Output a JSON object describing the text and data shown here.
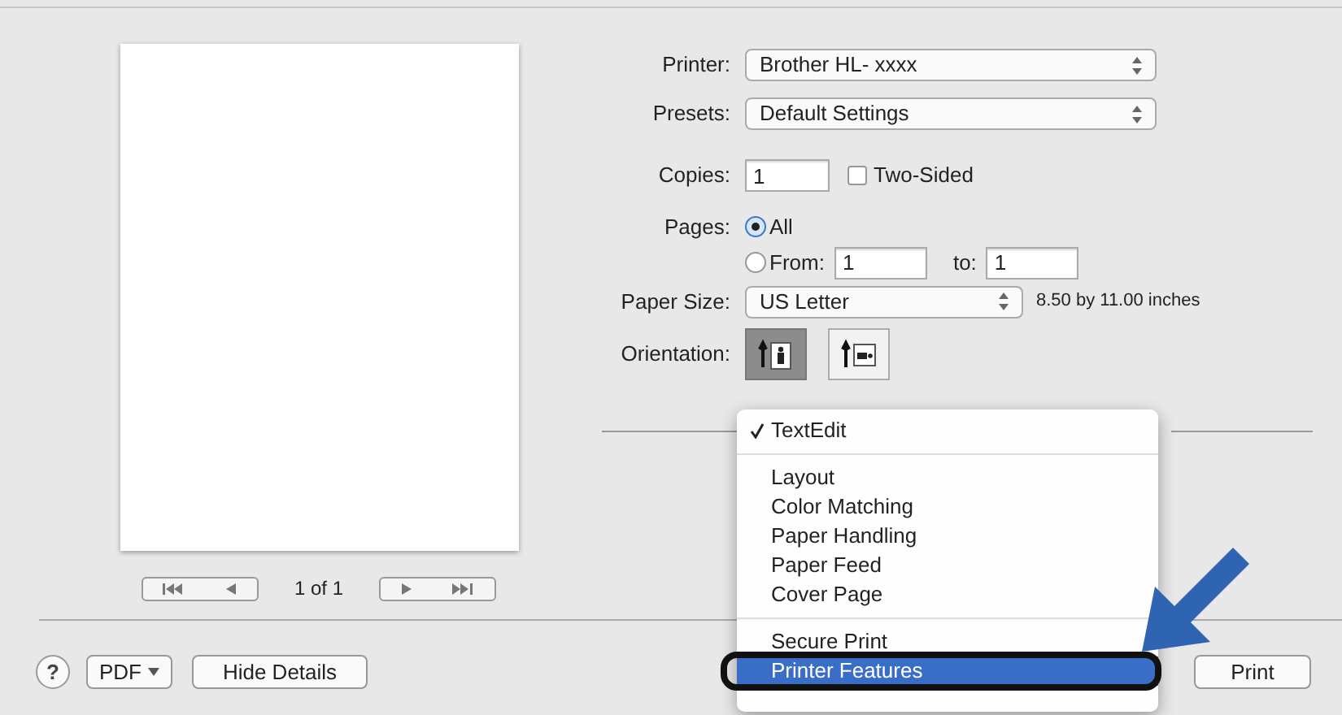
{
  "preview": {
    "page_count": "1 of 1"
  },
  "form": {
    "printer": {
      "label": "Printer:",
      "value": "Brother HL- xxxx"
    },
    "presets": {
      "label": "Presets:",
      "value": "Default Settings"
    },
    "copies": {
      "label": "Copies:",
      "value": "1"
    },
    "two_sided": {
      "label": "Two-Sided",
      "checked": false
    },
    "pages": {
      "label": "Pages:",
      "options": [
        {
          "label": "All",
          "selected": true
        },
        {
          "label": "From:",
          "selected": false
        }
      ],
      "from": "1",
      "to_label": "to:",
      "to": "1"
    },
    "paper_size": {
      "label": "Paper Size:",
      "value": "US Letter",
      "dimensions": "8.50 by 11.00 inches"
    },
    "orientation": {
      "label": "Orientation:",
      "options": [
        {
          "kind": "portrait",
          "selected": true
        },
        {
          "kind": "landscape",
          "selected": false
        }
      ]
    }
  },
  "menu": {
    "sections": [
      [
        {
          "label": "TextEdit",
          "checked": true,
          "selected": false
        }
      ],
      [
        {
          "label": "Layout",
          "checked": false,
          "selected": false
        },
        {
          "label": "Color Matching",
          "checked": false,
          "selected": false
        },
        {
          "label": "Paper Handling",
          "checked": false,
          "selected": false
        },
        {
          "label": "Paper Feed",
          "checked": false,
          "selected": false
        },
        {
          "label": "Cover Page",
          "checked": false,
          "selected": false
        }
      ],
      [
        {
          "label": "Secure Print",
          "checked": false,
          "selected": false
        },
        {
          "label": "Printer Features",
          "checked": false,
          "selected": true
        }
      ]
    ]
  },
  "footer": {
    "help": "?",
    "pdf": "PDF",
    "hide_details": "Hide Details",
    "print": "Print"
  }
}
